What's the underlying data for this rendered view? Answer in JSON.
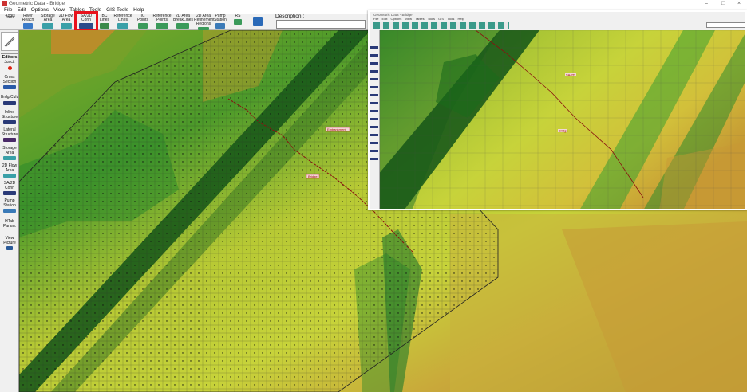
{
  "window": {
    "title": "Geometric Data - Bridge"
  },
  "menu": [
    "File",
    "Edit",
    "Options",
    "View",
    "Tables",
    "Tools",
    "GIS Tools",
    "Help"
  ],
  "toolbar": {
    "buttons": [
      {
        "label": "Tools",
        "icon": "tools-icon"
      },
      {
        "label": "River\nReach",
        "icon": "river-reach-icon"
      },
      {
        "label": "Storage\nArea",
        "icon": "storage-area-icon"
      },
      {
        "label": "2D Flow\nArea",
        "icon": "2d-flow-area-icon"
      },
      {
        "label": "SA/2D\nConn",
        "icon": "sa2d-conn-icon"
      },
      {
        "label": "BC\nLines",
        "icon": "bc-lines-icon"
      },
      {
        "label": "Reference\nLines",
        "icon": "reference-lines-icon"
      },
      {
        "label": "IC\nPoints",
        "icon": "ic-points-icon"
      },
      {
        "label": "Reference\nPoints",
        "icon": "reference-points-icon"
      },
      {
        "label": "2D Area\nBreakLines",
        "icon": "breaklines-icon"
      },
      {
        "label": "2D Area\nRefinement\nRegions",
        "icon": "refinement-regions-icon"
      },
      {
        "label": "Pump\nStation",
        "icon": "pump-station-icon"
      },
      {
        "label": "RS",
        "icon": "rs-icon"
      },
      {
        "label": "",
        "icon": "map-layers-icon"
      }
    ],
    "description_label": "Description :",
    "description_value": ""
  },
  "sidebar": {
    "tools_label": "Tools",
    "editors_label": "Editors",
    "items": [
      {
        "label": "Junct.",
        "icon": "junction-icon"
      },
      {
        "label": "Cross\nSection",
        "icon": "cross-section-icon"
      },
      {
        "label": "Brdg/Culv",
        "icon": "bridge-culvert-icon"
      },
      {
        "label": "Inline\nStructure",
        "icon": "inline-structure-icon"
      },
      {
        "label": "Lateral\nStructure",
        "icon": "lateral-structure-icon"
      },
      {
        "label": "Storage\nArea",
        "icon": "storage-area-icon"
      },
      {
        "label": "2D Flow\nArea",
        "icon": "2d-flow-area-icon"
      },
      {
        "label": "SA/2D\nConn",
        "icon": "sa2d-conn-icon"
      },
      {
        "label": "Pump\nStation",
        "icon": "pump-station-icon"
      },
      {
        "label": "HTab\nParam.",
        "icon": ""
      },
      {
        "label": "View\nPicture",
        "icon": "view-picture-icon"
      }
    ]
  },
  "map": {
    "connection_labels": [
      "Embankment",
      "Bridge"
    ],
    "colors": {
      "high": "#b07a2c",
      "mid": "#c3d23a",
      "low": "#1f7a2a",
      "channel": "#1a5a1a",
      "connection": "#8a1010"
    }
  },
  "inset": {
    "title": "Geometric Data - Bridge",
    "menu": "File Edit Options View Tables Tools GIS Tools Help",
    "labels": [
      "SA/2D",
      "Bridge"
    ]
  }
}
